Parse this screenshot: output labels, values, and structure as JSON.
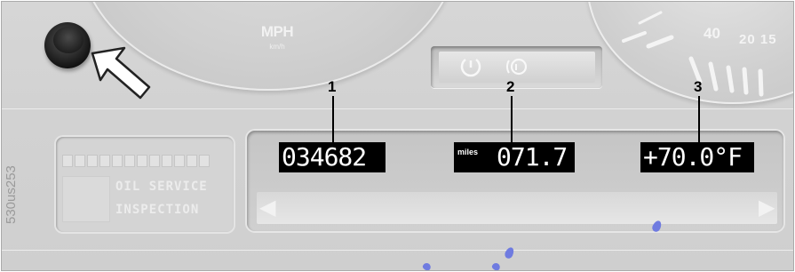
{
  "speedometer": {
    "unit_label": "MPH",
    "sub_label": "km/h"
  },
  "tachometer": {
    "mark_40": "40",
    "mark_20_15": "20 15"
  },
  "warning_lamps": [
    "tire-pressure-icon",
    "brake-wear-icon"
  ],
  "callouts": [
    "1",
    "2",
    "3"
  ],
  "display": {
    "odometer": "034682",
    "trip_unit": "miles",
    "trip_value": "071.7",
    "temperature": "+70.0°F"
  },
  "service": {
    "line1": "OIL SERVICE",
    "line2": "INSPECTION"
  },
  "side_code": "530us253",
  "colors": {
    "display_bg": "#000000",
    "display_text": "#ffffff",
    "panel": "#d2d2d2"
  }
}
